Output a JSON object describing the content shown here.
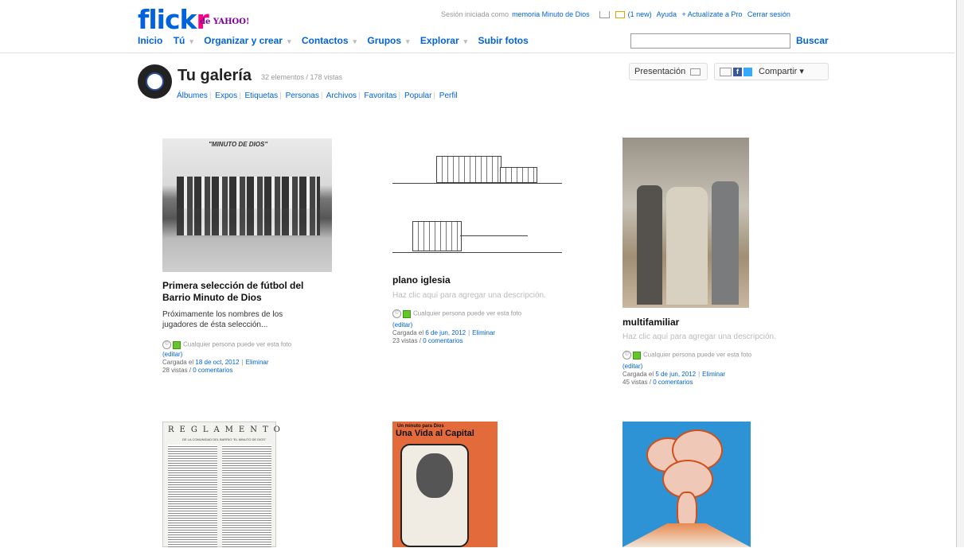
{
  "header": {
    "logo_main": "flickr",
    "logo_dot": "®",
    "logo_sub": "de YAHOO!",
    "session_text": "Sesión iniciada como",
    "username": "memoria Minuto de Dios",
    "new_mail": "(1 new)",
    "help": "Ayuda",
    "upgrade": "+ Actualízate a Pro",
    "logout": "Cerrar sesión",
    "search_button": "Buscar",
    "search_value": ""
  },
  "nav": {
    "items": [
      "Inicio",
      "Tú",
      "Organizar y crear",
      "Contactos",
      "Grupos",
      "Explorar",
      "Subir fotos"
    ],
    "dropdown_marker": "▾"
  },
  "gallery": {
    "title": "Tu galería",
    "meta": "32 elementos / 178 vistas",
    "subnav": [
      "Álbumes",
      "Expos",
      "Etiquetas",
      "Personas",
      "Archivos",
      "Favoritas",
      "Popular",
      "Perfil"
    ],
    "present_button": "Presentación",
    "share_button": "Compartir ▾",
    "fb_glyph": "f"
  },
  "photos": [
    {
      "title": "Primera selección de fútbol del Barrio Minuto de Dios",
      "description": "Próximamente los nombres de los jugadores de ésta selección...",
      "photo_caption": "\"MINUTO DE DIOS\"",
      "privacy": "Cualquier persona puede ver esta foto",
      "edit": "(editar)",
      "uploaded_label": "Cargada el",
      "uploaded_date": "18 de oct, 2012",
      "delete": "Eliminar",
      "views": "28 vistas /",
      "comments": "0 comentarios"
    },
    {
      "title": "plano iglesia",
      "description": "Haz clic aquí para agregar una descripción.",
      "privacy": "Cualquier persona puede ver esta foto",
      "edit": "(editar)",
      "uploaded_label": "Cargada el",
      "uploaded_date": "6 de jun, 2012",
      "delete": "Eliminar",
      "views": "23 vistas /",
      "comments": "0 comentarios"
    },
    {
      "title": "multifamiliar",
      "description": "Haz clic aquí para agregar una descripción.",
      "privacy": "Cualquier persona puede ver esta foto",
      "edit": "(editar)",
      "uploaded_label": "Cargada el",
      "uploaded_date": "5 de jun, 2012",
      "delete": "Eliminar",
      "views": "45 vistas /",
      "comments": "0 comentarios"
    },
    {
      "photo_heading": "REGLAMENTO",
      "photo_subheading": "DE LA COMUNIDAD DEL BARRIO \"EL MINUTO DE DIOS\""
    },
    {
      "photo_kicker": "Un minuto para Dios",
      "photo_heading": "Una Vida al  Capital"
    },
    {}
  ],
  "colors": {
    "link": "#0063dc",
    "flickr_pink": "#ff0084",
    "accent_green": "#65c52a"
  }
}
